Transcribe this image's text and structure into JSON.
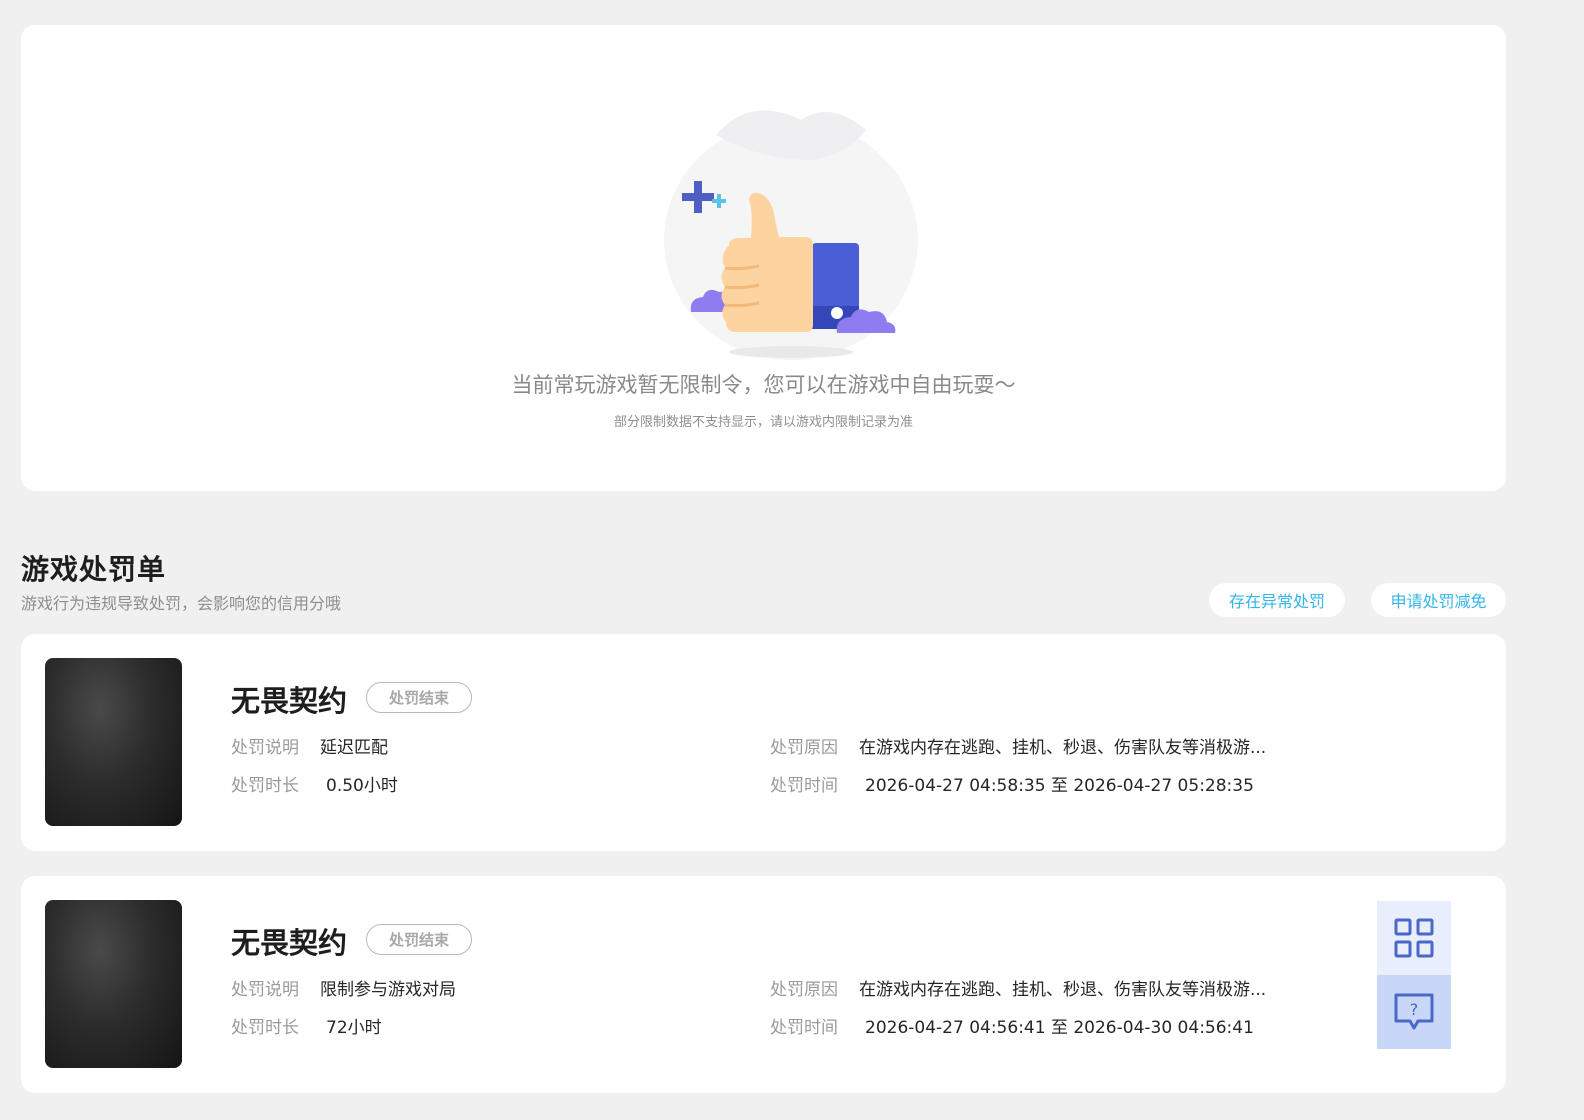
{
  "restrictions": {
    "empty_message": "当前常玩游戏暂无限制令，您可以在游戏中自由玩耍～",
    "empty_note": "部分限制数据不支持显示，请以游戏内限制记录为准"
  },
  "penalties": {
    "title": "游戏处罚单",
    "description": "游戏行为违规导致处罚，会影响您的信用分哦",
    "abnormal_button": "存在异常处罚",
    "relief_button": "申请处罚减免",
    "labels": {
      "desc": "处罚说明",
      "duration": "处罚时长",
      "reason": "处罚原因",
      "time": "处罚时间"
    },
    "records": [
      {
        "game": "无畏契约",
        "status": "处罚结束",
        "desc": "延迟匹配",
        "duration": "0.50小时",
        "reason": "在游戏内存在逃跑、挂机、秒退、伤害队友等消极游...",
        "time": "2026-04-27 04:58:35 至 2026-04-27 05:28:35"
      },
      {
        "game": "无畏契约",
        "status": "处罚结束",
        "desc": "限制参与游戏对局",
        "duration": "72小时",
        "reason": "在游戏内存在逃跑、挂机、秒退、伤害队友等消极游...",
        "time": "2026-04-27 04:56:41 至 2026-04-30 04:56:41"
      }
    ]
  },
  "side_widget": {
    "qr_icon": "qr-code-icon",
    "help_icon": "help-chat-icon"
  },
  "colors": {
    "accent": "#34b5e8",
    "thumb_blue": "#4a5ed6",
    "widget_blue": "#4a67c9"
  }
}
